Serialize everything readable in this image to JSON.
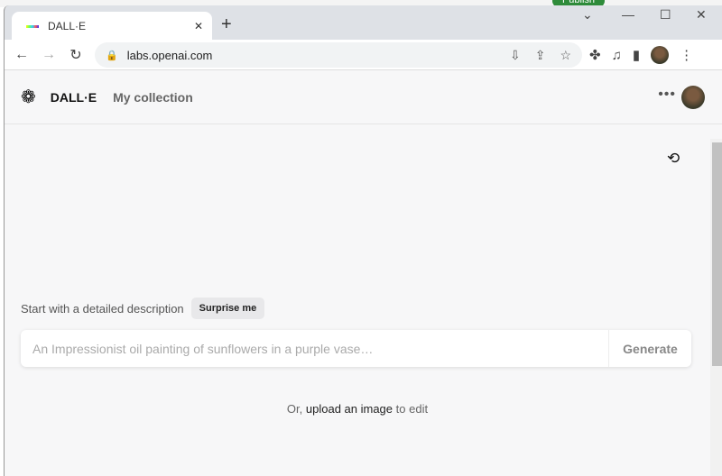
{
  "background": {
    "publish_label": "Publish"
  },
  "browser": {
    "tab_title": "DALL·E",
    "url": "labs.openai.com",
    "icons": [
      "back-icon",
      "forward-icon",
      "reload-icon",
      "lock-icon",
      "install-icon",
      "share-icon",
      "star-icon",
      "extensions-icon",
      "media-icon",
      "side-panel-icon",
      "profile-avatar",
      "menu-icon"
    ]
  },
  "app": {
    "brand": "DALL·E",
    "nav_collection": "My collection",
    "start_text": "Start with a detailed description",
    "surprise_label": "Surprise me",
    "prompt_placeholder": "An Impressionist oil painting of sunflowers in a purple vase…",
    "generate_label": "Generate",
    "upload_prefix": "Or,",
    "upload_link": "upload an image",
    "upload_suffix": "to edit"
  }
}
